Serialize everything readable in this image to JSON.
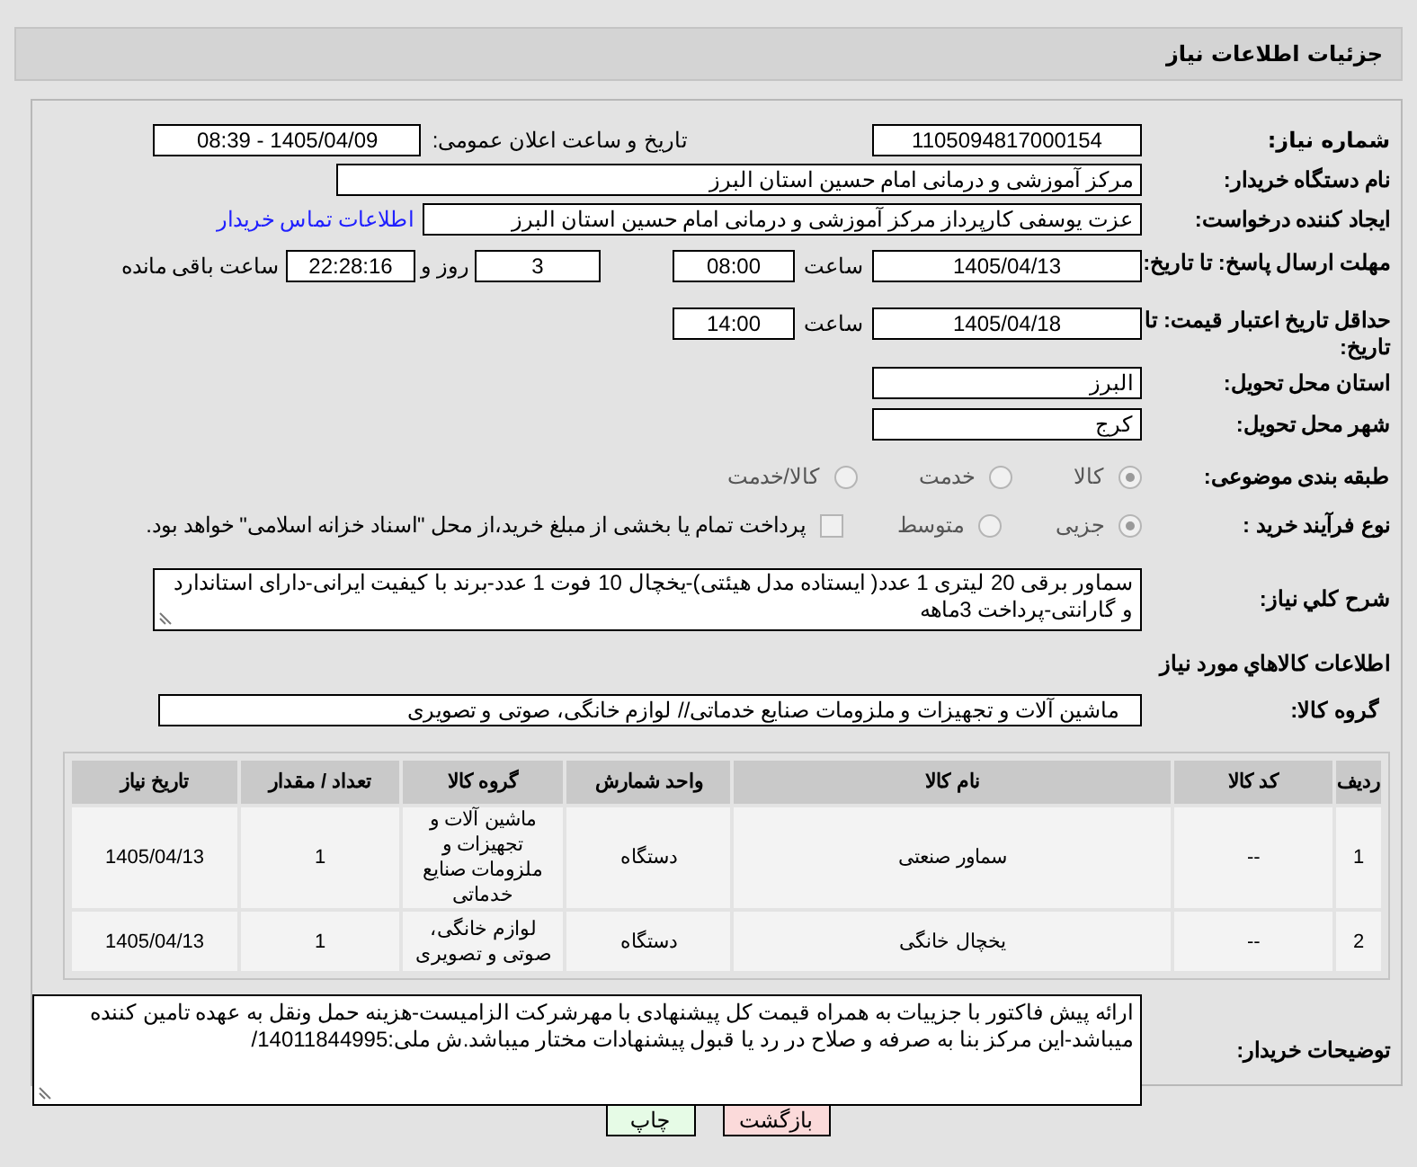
{
  "header": {
    "title": "جزئیات اطلاعات نیاز"
  },
  "need_number": {
    "label": "شماره نیاز:",
    "value": "1105094817000154"
  },
  "announce": {
    "label": "تاریخ و ساعت اعلان عمومی:",
    "value": "1405/04/09 - 08:39"
  },
  "buyer_org": {
    "label": "نام دستگاه خریدار:",
    "value": "مرکز آموزشی و درمانی امام حسین استان البرز"
  },
  "requester": {
    "label": "ایجاد کننده درخواست:",
    "value": "عزت یوسفی کارپرداز مرکز آموزشی و درمانی امام حسین استان البرز",
    "link": "اطلاعات تماس خریدار"
  },
  "deadline": {
    "label": "مهلت ارسال پاسخ: تا تاریخ:",
    "date": "1405/04/13",
    "time_label": "ساعت",
    "time": "08:00",
    "days": "3",
    "days_label": "روز و",
    "remaining": "22:28:16",
    "remaining_label": "ساعت باقی مانده"
  },
  "validity": {
    "label": "حداقل تاریخ اعتبار قیمت: تا تاریخ:",
    "date": "1405/04/18",
    "time_label": "ساعت",
    "time": "14:00"
  },
  "province": {
    "label": "استان محل تحویل:",
    "value": "البرز"
  },
  "city": {
    "label": "شهر محل تحویل:",
    "value": "کرج"
  },
  "category": {
    "label": "طبقه بندی موضوعی:",
    "options": [
      {
        "label": "کالا",
        "selected": true
      },
      {
        "label": "خدمت",
        "selected": false
      },
      {
        "label": "کالا/خدمت",
        "selected": false
      }
    ]
  },
  "process": {
    "label": "نوع فرآیند خرید :",
    "options": [
      {
        "label": "جزیی",
        "selected": true
      },
      {
        "label": "متوسط",
        "selected": false
      }
    ],
    "payment": {
      "label": "پرداخت تمام یا بخشی از مبلغ خرید،از محل \"اسناد خزانه اسلامی\" خواهد بود.",
      "checked": false
    }
  },
  "description": {
    "label": "شرح کلي نياز:",
    "value": "سماور برقی 20 لیتری 1 عدد( ایستاده مدل هیئتی)-یخچال 10 فوت 1 عدد-برند با کیفیت ایرانی-دارای استاندارد و گارانتی-پرداخت 3ماهه"
  },
  "goods": {
    "heading": "اطلاعات کالاهاي مورد نياز",
    "group": {
      "label": "گروه کالا:",
      "value": "ماشین آلات و تجهیزات و ملزومات صنایع خدماتی// لوازم خانگی، صوتی و تصویری"
    },
    "table": {
      "columns": [
        "ردیف",
        "کد کالا",
        "نام کالا",
        "واحد شمارش",
        "گروه کالا",
        "تعداد / مقدار",
        "تاریخ نیاز"
      ],
      "rows": [
        [
          "1",
          "--",
          "سماور صنعتی",
          "دستگاه",
          "ماشین آلات و تجهیزات و ملزومات صنایع خدماتی",
          "1",
          "1405/04/13"
        ],
        [
          "2",
          "--",
          "یخچال خانگی",
          "دستگاه",
          "لوازم خانگی، صوتی و تصویری",
          "1",
          "1405/04/13"
        ]
      ]
    }
  },
  "buyer_notes": {
    "label": "توضیحات خریدار:",
    "value": "ارائه پیش فاکتور با جزییات به همراه قیمت کل پیشنهادی با مهرشرکت الزامیست-هزینه حمل ونقل به عهده تامین کننده میباشد-این مرکز بنا به صرفه و صلاح در رد یا قبول پیشنهادات مختار میباشد.ش ملی:14011844995/"
  },
  "buttons": [
    {
      "label": "بازگشت",
      "kind": "back"
    },
    {
      "label": "چاپ",
      "kind": "print"
    }
  ]
}
